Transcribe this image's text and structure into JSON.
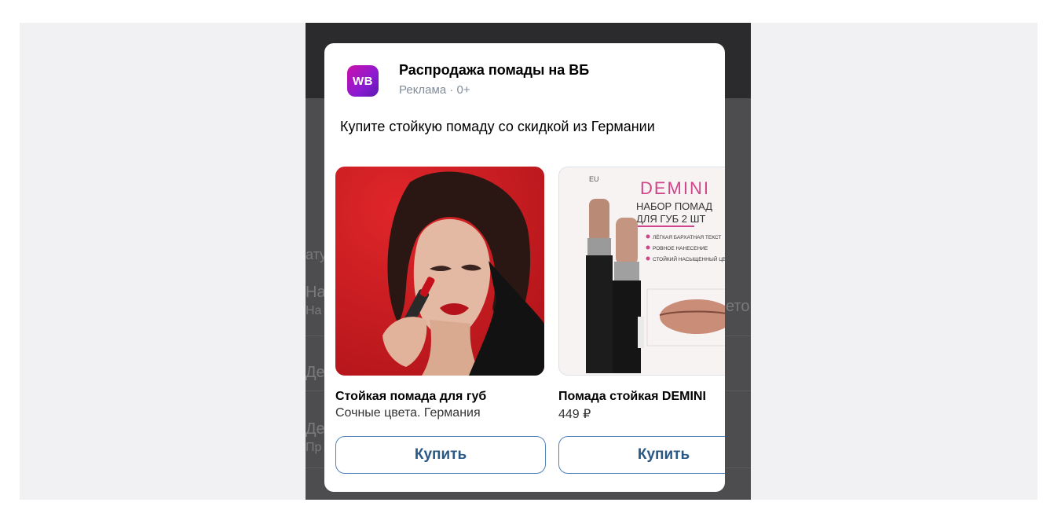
{
  "underlay": {
    "fragments": [
      "ату",
      "На",
      "На",
      "Де",
      "Де",
      "Пр",
      "ето"
    ]
  },
  "ad": {
    "logo_text": "WB",
    "title": "Распродажа помады на ВБ",
    "meta": "Реклама · 0+",
    "description": "Купите стойкую помаду со скидкой из Германии",
    "products": [
      {
        "title": "Стойкая помада для губ",
        "subtitle": "Сочные цвета. Германия",
        "button_label": "Купить"
      },
      {
        "title": "Помада стойкая DEMINI",
        "subtitle": "449 ₽",
        "button_label": "Купить",
        "image_text": {
          "brand_badge": "EU",
          "brand": "DEMINI",
          "headline_1": "НАБОР ПОМАД",
          "headline_2": "ДЛЯ ГУБ 2 ШТ",
          "bullets": [
            "ЛЁГКАЯ БАРХАТНАЯ ТЕКСТ",
            "РОВНОЕ НАНЕСЕНИЕ",
            "СТОЙКИЙ НАСЫЩЕННЫЙ ЦВ"
          ]
        }
      }
    ]
  },
  "colors": {
    "brand_gradient_start": "#cb11ab",
    "brand_gradient_end": "#5b1ab0",
    "button_border": "#5181b8",
    "button_text": "#2a5885"
  }
}
